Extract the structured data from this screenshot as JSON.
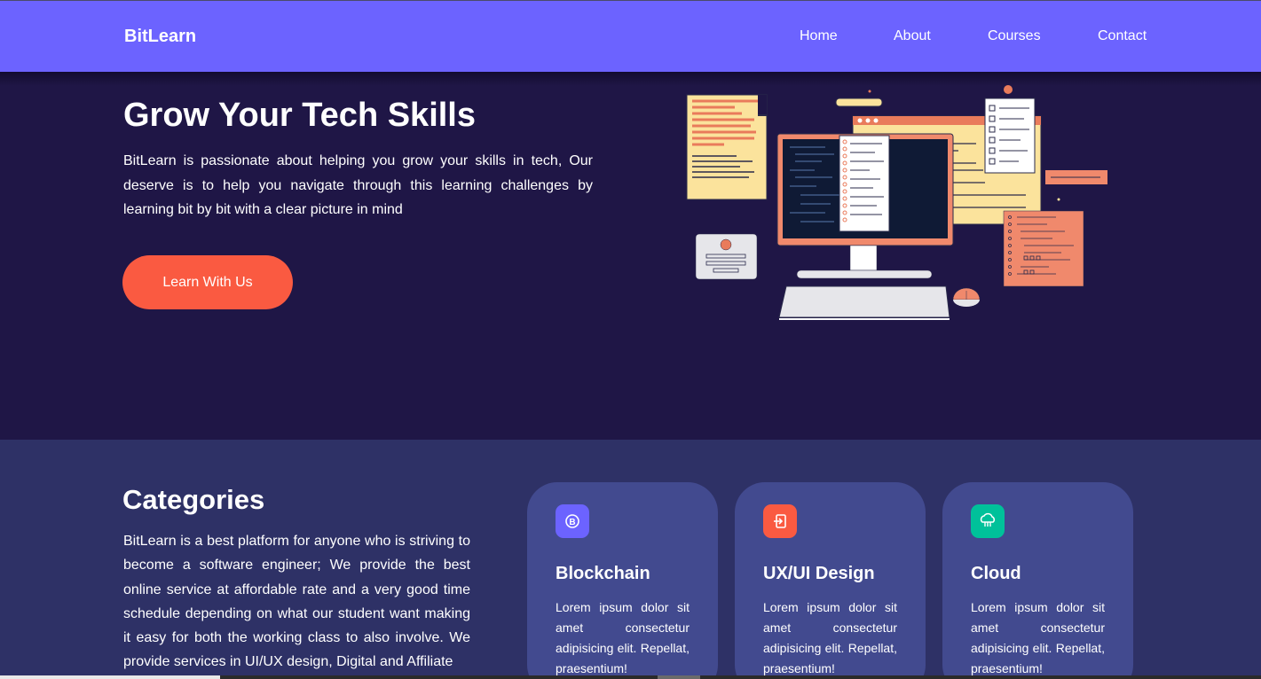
{
  "nav": {
    "brand": "BitLearn",
    "links": [
      "Home",
      "About",
      "Courses",
      "Contact"
    ]
  },
  "hero": {
    "title": "Grow Your Tech Skills",
    "text": "BitLearn is passionate about helping you grow your skills in tech, Our deserve is to help you navigate through this learning challenges by learning bit by bit with a clear picture in mind",
    "button": "Learn With Us"
  },
  "categories": {
    "title": "Categories",
    "text": "BitLearn is a best platform for anyone who is striving to become a software engineer; We provide the best online service at affordable rate and a very good time schedule depending on what our student want making it easy for both the working class to also involve. We provide services in UI/UX design, Digital and Affiliate",
    "cards": [
      {
        "title": "Blockchain",
        "text": "Lorem ipsum dolor sit amet consectetur adipisicing elit. Repellat, praesentium!",
        "icon": "bitcoin-icon",
        "color": "#6c63ff"
      },
      {
        "title": "UX/UI Design",
        "text": "Lorem ipsum dolor sit amet consectetur adipisicing elit. Repellat, praesentium!",
        "icon": "login-icon",
        "color": "#fa5a41"
      },
      {
        "title": "Cloud",
        "text": "Lorem ipsum dolor sit amet consectetur adipisicing elit. Repellat, praesentium!",
        "icon": "cloud-network-icon",
        "color": "#00c19a"
      }
    ]
  },
  "colors": {
    "navbar": "#6c63ff",
    "hero_bg": "#1f1646",
    "categories_bg": "#2e3166",
    "card_bg": "#424a8f",
    "accent": "#fa5a41"
  }
}
